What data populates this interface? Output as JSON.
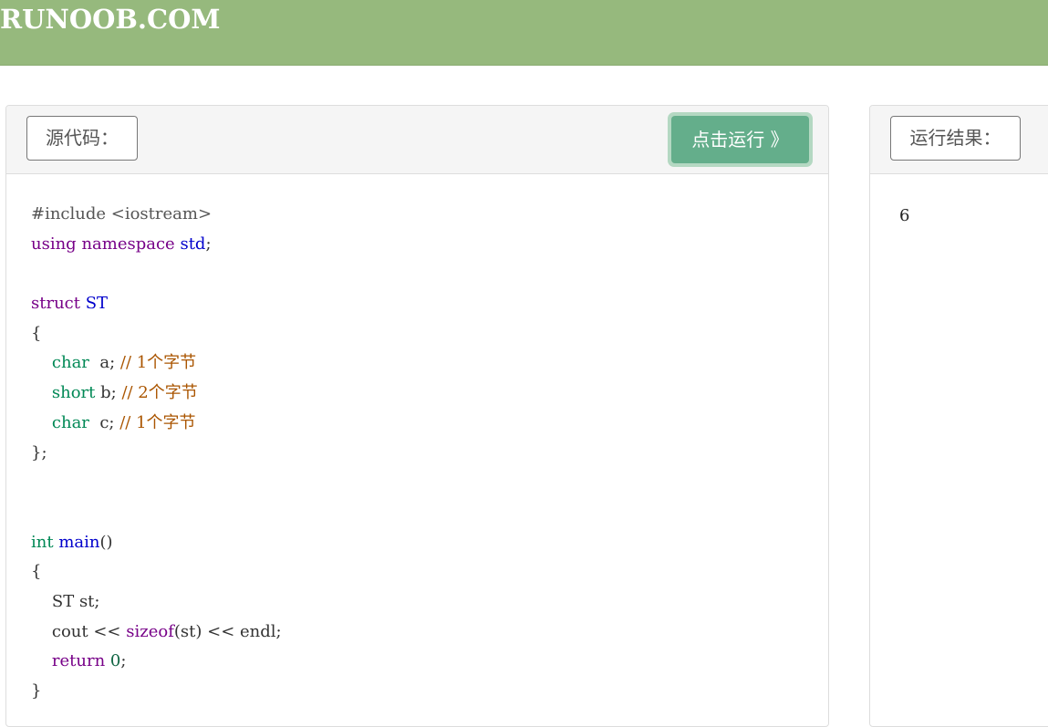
{
  "header": {
    "logo_text": "RUNOOB.COM",
    "background_color": "#96b97d"
  },
  "editor": {
    "label": "源代码：",
    "run_button": "点击运行 》",
    "run_button_color": "#64ae8b",
    "lines": [
      [
        {
          "t": "#include <iostream>",
          "c": "pre"
        }
      ],
      [
        {
          "t": "using",
          "c": "kw"
        },
        {
          "t": " ",
          "c": "plain"
        },
        {
          "t": "namespace",
          "c": "kw"
        },
        {
          "t": " ",
          "c": "plain"
        },
        {
          "t": "std",
          "c": "def"
        },
        {
          "t": ";",
          "c": "plain"
        }
      ],
      [],
      [
        {
          "t": "struct",
          "c": "kw"
        },
        {
          "t": " ",
          "c": "plain"
        },
        {
          "t": "ST",
          "c": "def"
        }
      ],
      [
        {
          "t": "{",
          "c": "plain"
        }
      ],
      [
        {
          "t": "    ",
          "c": "plain"
        },
        {
          "t": "char",
          "c": "type"
        },
        {
          "t": "  a; ",
          "c": "plain"
        },
        {
          "t": "// 1个字节",
          "c": "com"
        }
      ],
      [
        {
          "t": "    ",
          "c": "plain"
        },
        {
          "t": "short",
          "c": "type"
        },
        {
          "t": " b; ",
          "c": "plain"
        },
        {
          "t": "// 2个字节",
          "c": "com"
        }
      ],
      [
        {
          "t": "    ",
          "c": "plain"
        },
        {
          "t": "char",
          "c": "type"
        },
        {
          "t": "  c; ",
          "c": "plain"
        },
        {
          "t": "// 1个字节",
          "c": "com"
        }
      ],
      [
        {
          "t": "};",
          "c": "plain"
        }
      ],
      [],
      [],
      [
        {
          "t": "int",
          "c": "type"
        },
        {
          "t": " ",
          "c": "plain"
        },
        {
          "t": "main",
          "c": "def"
        },
        {
          "t": "()",
          "c": "plain"
        }
      ],
      [
        {
          "t": "{",
          "c": "plain"
        }
      ],
      [
        {
          "t": "    ST st;",
          "c": "plain"
        }
      ],
      [
        {
          "t": "    cout << ",
          "c": "plain"
        },
        {
          "t": "sizeof",
          "c": "kw"
        },
        {
          "t": "(st) << endl;",
          "c": "plain"
        }
      ],
      [
        {
          "t": "    ",
          "c": "plain"
        },
        {
          "t": "return",
          "c": "kw"
        },
        {
          "t": " ",
          "c": "plain"
        },
        {
          "t": "0",
          "c": "num"
        },
        {
          "t": ";",
          "c": "plain"
        }
      ],
      [
        {
          "t": "}",
          "c": "plain"
        }
      ]
    ]
  },
  "result": {
    "label": "运行结果：",
    "output": "6"
  }
}
